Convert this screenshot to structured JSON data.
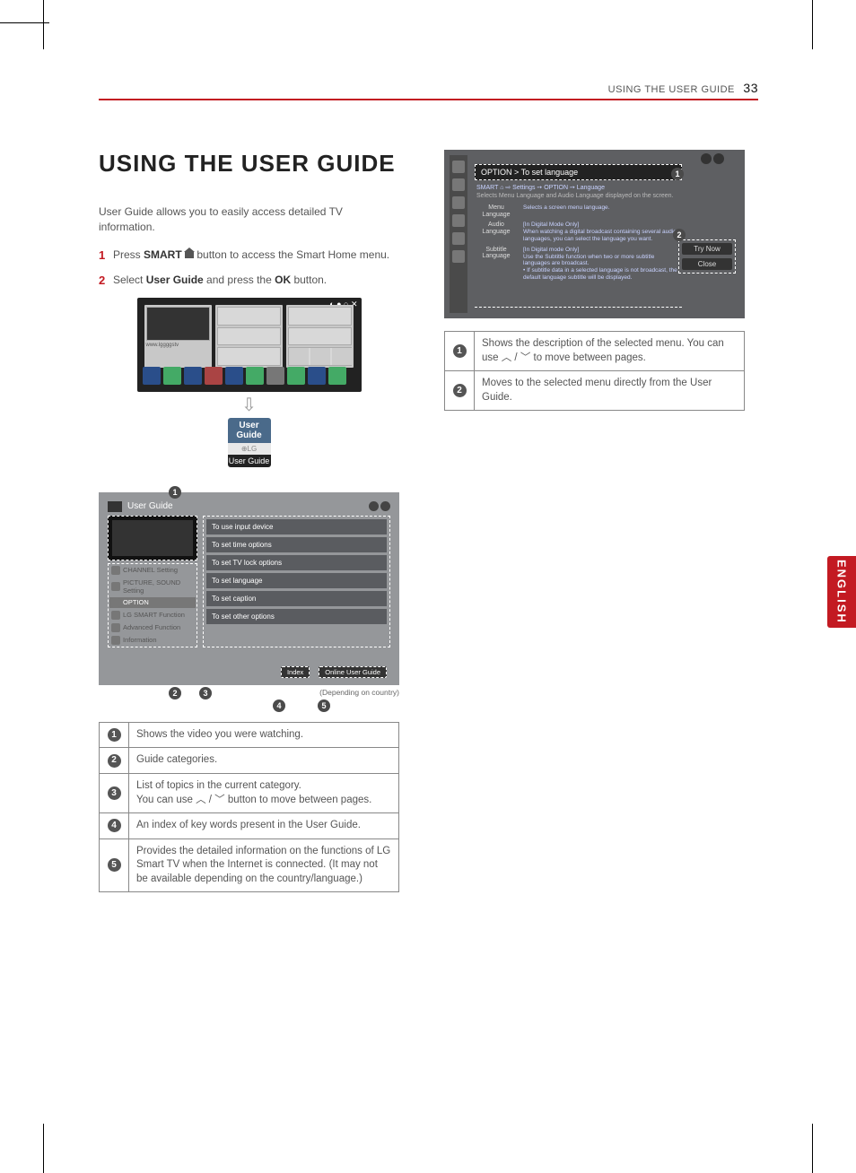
{
  "header": {
    "section": "USING THE USER GUIDE",
    "page": "33"
  },
  "title": "USING THE USER GUIDE",
  "intro": "User Guide allows you to easily access detailed TV information.",
  "steps": [
    {
      "n": "1",
      "pre": "Press ",
      "bold": "SMART",
      "post": " button to access the Smart Home menu."
    },
    {
      "n": "2",
      "pre": "Select ",
      "bold": "User Guide",
      "mid": " and press the ",
      "bold2": "OK",
      "post": " button."
    }
  ],
  "ug_icon": {
    "title": "User\nGuide",
    "brand": "⊕LG",
    "label": "User Guide"
  },
  "ug_panel": {
    "header": "User Guide",
    "categories": [
      "CHANNEL Setting",
      "PICTURE, SOUND Setting",
      "OPTION",
      "LG SMART Function",
      "Advanced Function",
      "Information"
    ],
    "topics": [
      "To use input device",
      "To set time options",
      "To set TV lock options",
      "To set language",
      "To set caption",
      "To set other options"
    ],
    "footer": {
      "index": "Index",
      "online": "Online User Guide"
    },
    "depending": "(Depending on country)"
  },
  "legend1": [
    "Shows the video you were watching.",
    "Guide categories.",
    "List of topics in the current category.\nYou can use ︿ / ﹀ button to move between pages.",
    "An index of key words present in the User Guide.",
    "Provides the detailed information on the functions of LG Smart TV when the Internet is connected. (It may not be available depending on the country/language.)"
  ],
  "detail": {
    "breadcrumb": "OPTION > To set language",
    "path": "SMART ⌂ ⇨ Settings ➙ OPTION ➙ Language",
    "desc": "Selects Menu Language and Audio Language displayed on the screen.",
    "rows": [
      {
        "label": "Menu Language",
        "text": "Selects a screen menu language."
      },
      {
        "label": "Audio Language",
        "text": "[In Digital Mode Only]\nWhen watching a digital broadcast containing several audio languages, you can select the language you want."
      },
      {
        "label": "Subtitle Language",
        "text": "[In Digital mode Only]\nUse the Subtitle function when two or more subtitle languages are broadcast.\n• If subtitle data in a selected language is not broadcast, the default language subtitle will be displayed."
      }
    ],
    "buttons": {
      "try": "Try Now",
      "close": "Close"
    }
  },
  "legend2": [
    "Shows the description of the selected menu. You can use ︿ / ﹀ to move between pages.",
    "Moves to the selected menu directly from the User Guide."
  ],
  "side_tab": "ENGLISH",
  "markers": [
    "1",
    "2",
    "3",
    "4",
    "5"
  ]
}
